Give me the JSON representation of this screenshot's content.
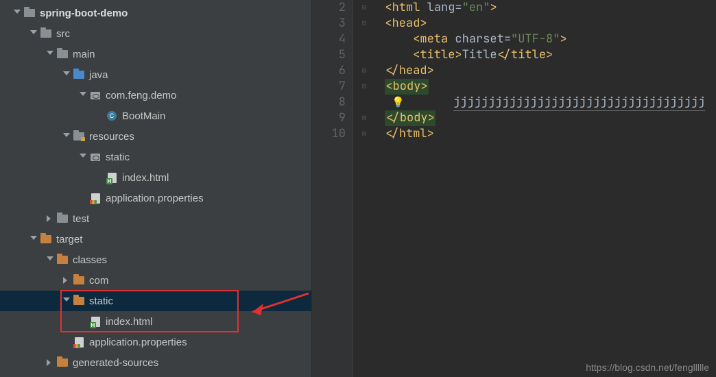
{
  "tree": [
    {
      "depth": 0,
      "arrow": "down",
      "icon": "folder",
      "label": "spring-boot-demo",
      "bold": true
    },
    {
      "depth": 1,
      "arrow": "down",
      "icon": "folder",
      "label": "src"
    },
    {
      "depth": 2,
      "arrow": "down",
      "icon": "folder",
      "label": "main"
    },
    {
      "depth": 3,
      "arrow": "down",
      "icon": "folder-blue",
      "label": "java"
    },
    {
      "depth": 4,
      "arrow": "down",
      "icon": "pkg",
      "label": "com.feng.demo"
    },
    {
      "depth": 5,
      "arrow": "none",
      "icon": "class",
      "label": "BootMain"
    },
    {
      "depth": 3,
      "arrow": "down",
      "icon": "folder-resources",
      "label": "resources"
    },
    {
      "depth": 4,
      "arrow": "down",
      "icon": "pkg",
      "label": "static"
    },
    {
      "depth": 5,
      "arrow": "none",
      "icon": "html",
      "label": "index.html"
    },
    {
      "depth": 4,
      "arrow": "none",
      "icon": "prop",
      "label": "application.properties"
    },
    {
      "depth": 2,
      "arrow": "right",
      "icon": "folder",
      "label": "test"
    },
    {
      "depth": 1,
      "arrow": "down",
      "icon": "folder-orange",
      "label": "target"
    },
    {
      "depth": 2,
      "arrow": "down",
      "icon": "folder-orange",
      "label": "classes"
    },
    {
      "depth": 3,
      "arrow": "right",
      "icon": "folder-orange",
      "label": "com"
    },
    {
      "depth": 3,
      "arrow": "down",
      "icon": "folder-orange",
      "label": "static",
      "selected": true
    },
    {
      "depth": 4,
      "arrow": "none",
      "icon": "html",
      "label": "index.html"
    },
    {
      "depth": 3,
      "arrow": "none",
      "icon": "prop",
      "label": "application.properties"
    },
    {
      "depth": 2,
      "arrow": "right",
      "icon": "folder-orange",
      "label": "generated-sources"
    }
  ],
  "gutter_start": 2,
  "gutter_end": 10,
  "code": {
    "l2": {
      "indent": "  ",
      "open": "<",
      "tag": "html",
      "attrs": " lang=",
      "str": "\"en\"",
      "close": ">"
    },
    "l3": {
      "indent": "  ",
      "open": "<",
      "tag": "head",
      "close": ">"
    },
    "l4": {
      "indent": "      ",
      "open": "<",
      "tag": "meta",
      "attrs": " charset=",
      "str": "\"UTF-8\"",
      "close": ">"
    },
    "l5": {
      "indent": "      ",
      "open": "<",
      "tag": "title",
      "close": ">",
      "text": "Title",
      "open2": "</",
      "tag2": "title",
      "close2": ">"
    },
    "l6": {
      "indent": "  ",
      "open": "</",
      "tag": "head",
      "close": ">"
    },
    "l7": {
      "indent": "  ",
      "open": "<",
      "tag": "body",
      "close": ">",
      "hl": true
    },
    "l8": {
      "text": "jjjjjjjjjjjjjjjjjjjjjjjjjjjjjjjjjjjj"
    },
    "l9": {
      "indent": "  ",
      "open": "</",
      "tag": "body",
      "close": ">",
      "hl": true
    },
    "l10": {
      "indent": "  ",
      "open": "</",
      "tag": "html",
      "close": ">"
    }
  },
  "watermark": "https://blog.csdn.net/fengllllle"
}
